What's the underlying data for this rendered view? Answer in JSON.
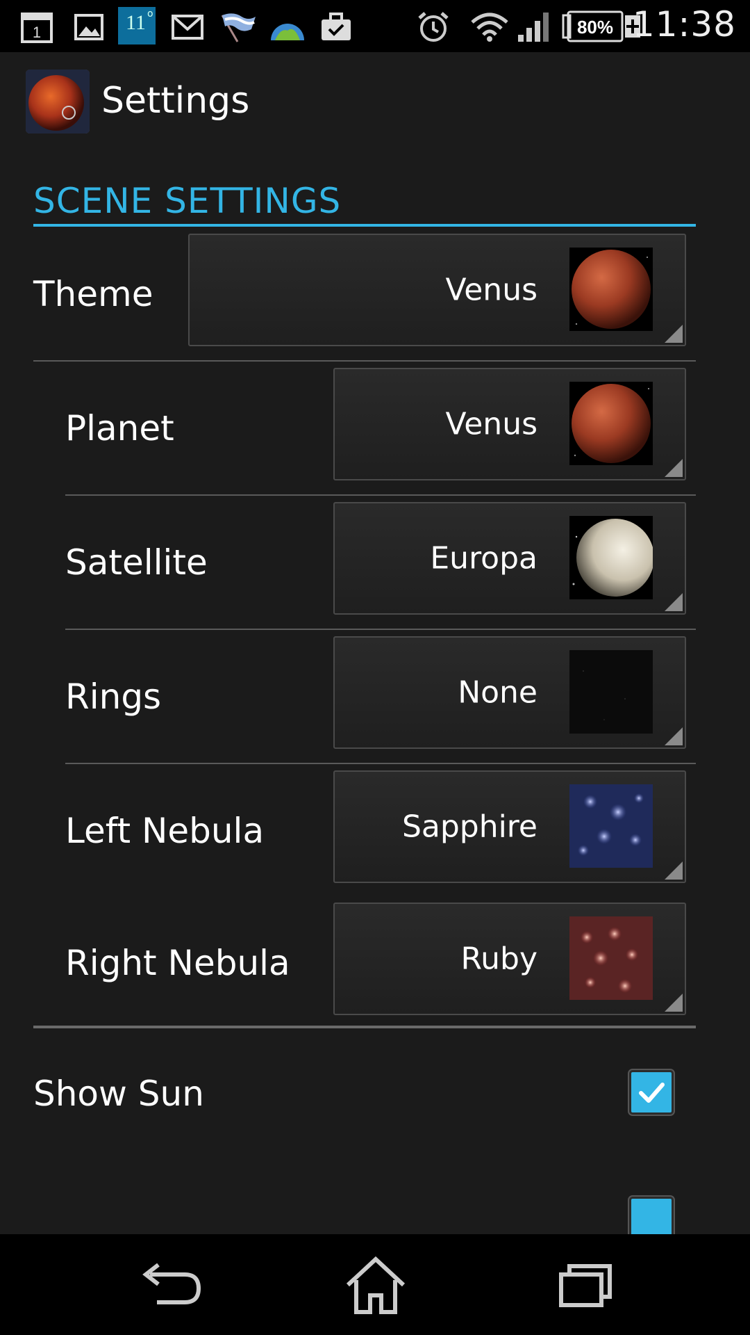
{
  "status_bar": {
    "calendar_day": "1",
    "weather_temp": "11",
    "battery": "80%",
    "time": "11:38",
    "icons": [
      "calendar-icon",
      "gallery-icon",
      "weather-icon",
      "gmail-icon",
      "flag-icon",
      "globe-icon",
      "briefcase-icon",
      "alarm-icon",
      "wifi-icon",
      "signal-icon",
      "battery-icon"
    ]
  },
  "action_bar": {
    "title": "Settings",
    "icon": "planet-app-icon"
  },
  "section": {
    "title": "SCENE SETTINGS"
  },
  "settings": [
    {
      "label": "Theme",
      "value": "Venus",
      "thumb": "venus"
    },
    {
      "label": "Planet",
      "value": "Venus",
      "thumb": "venus"
    },
    {
      "label": "Satellite",
      "value": "Europa",
      "thumb": "europa"
    },
    {
      "label": "Rings",
      "value": "None",
      "thumb": "none"
    },
    {
      "label": "Left Nebula",
      "value": "Sapphire",
      "thumb": "sapphire"
    },
    {
      "label": "Right Nebula",
      "value": "Ruby",
      "thumb": "ruby"
    }
  ],
  "toggles": [
    {
      "label": "Show Sun",
      "checked": true
    }
  ],
  "nav": {
    "back": "back-icon",
    "home": "home-icon",
    "recents": "recents-icon"
  },
  "colors": {
    "accent": "#33b5e5",
    "background": "#1b1b1b"
  }
}
